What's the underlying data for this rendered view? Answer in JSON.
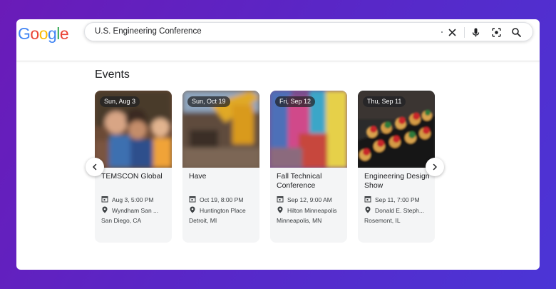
{
  "logo": {
    "letters": [
      "G",
      "o",
      "o",
      "g",
      "l",
      "e"
    ]
  },
  "search": {
    "query": "U.S. Engineering Conference"
  },
  "icons": {
    "clear": "close-icon",
    "voice": "microphone-icon",
    "lens": "camera-lens-icon",
    "search": "search-icon",
    "prev": "chevron-left-icon",
    "next": "chevron-right-icon"
  },
  "section": {
    "title": "Events"
  },
  "events": [
    {
      "date": "Sun, Aug 3",
      "title": "TEMSCON Global",
      "time": "Aug 3, 5:00 PM",
      "venue": "Wyndham San ...",
      "city": "San Diego, CA"
    },
    {
      "date": "Sun, Oct 19",
      "title": "Have",
      "time": "Oct 19, 8:00 PM",
      "venue": "Huntington Place",
      "city": "Detroit, MI"
    },
    {
      "date": "Fri, Sep 12",
      "title": "Fall Technical Conference",
      "time": "Sep 12, 9:00 AM",
      "venue": "Hilton Minneapolis",
      "city": "Minneapolis, MN"
    },
    {
      "date": "Thu, Sep 11",
      "title": "Engineering Design Show",
      "time": "Sep 11, 7:00 PM",
      "venue": "Donald E. Steph...",
      "city": "Rosemont, IL"
    }
  ]
}
